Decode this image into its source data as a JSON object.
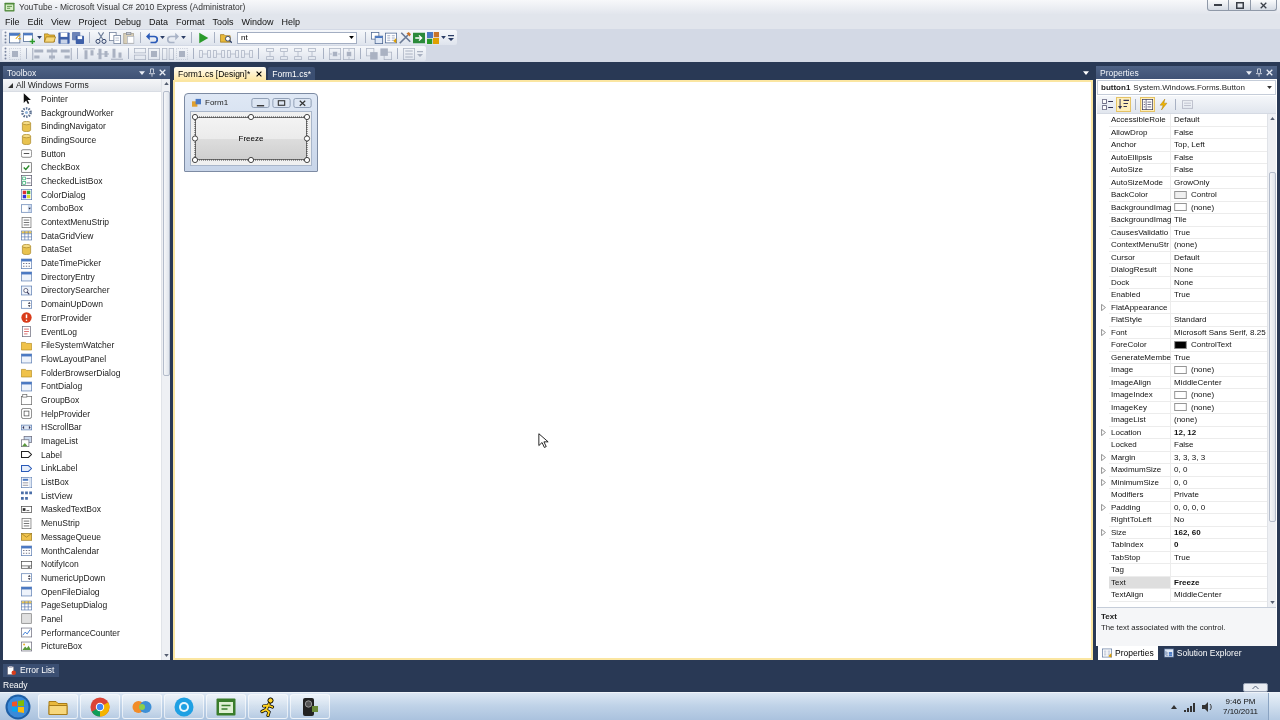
{
  "window": {
    "title": "YouTube - Microsoft Visual C# 2010 Express (Administrator)"
  },
  "menu": [
    "File",
    "Edit",
    "View",
    "Project",
    "Debug",
    "Data",
    "Format",
    "Tools",
    "Window",
    "Help"
  ],
  "standard_toolbar": {
    "find_value": "nt"
  },
  "layout_toolbar": {
    "disabled": true
  },
  "toolbox": {
    "title": "Toolbox",
    "group": {
      "label": "All Windows Forms",
      "expanded": true
    },
    "items": [
      "Pointer",
      "BackgroundWorker",
      "BindingNavigator",
      "BindingSource",
      "Button",
      "CheckBox",
      "CheckedListBox",
      "ColorDialog",
      "ComboBox",
      "ContextMenuStrip",
      "DataGridView",
      "DataSet",
      "DateTimePicker",
      "DirectoryEntry",
      "DirectorySearcher",
      "DomainUpDown",
      "ErrorProvider",
      "EventLog",
      "FileSystemWatcher",
      "FlowLayoutPanel",
      "FolderBrowserDialog",
      "FontDialog",
      "GroupBox",
      "HelpProvider",
      "HScrollBar",
      "ImageList",
      "Label",
      "LinkLabel",
      "ListBox",
      "ListView",
      "MaskedTextBox",
      "MenuStrip",
      "MessageQueue",
      "MonthCalendar",
      "NotifyIcon",
      "NumericUpDown",
      "OpenFileDialog",
      "PageSetupDialog",
      "Panel",
      "PerformanceCounter",
      "PictureBox"
    ]
  },
  "document_tabs": [
    {
      "label": "Form1.cs [Design]*",
      "selected": true
    },
    {
      "label": "Form1.cs*",
      "selected": false
    }
  ],
  "designer": {
    "form_title": "Form1",
    "button": {
      "text": "Freeze",
      "selected": true
    }
  },
  "properties": {
    "title": "Properties",
    "object_name": "button1",
    "object_type": "System.Windows.Forms.Button",
    "view_buttons": [
      {
        "selected": false,
        "disabled": false
      },
      {
        "selected": true,
        "disabled": false
      },
      {
        "selected": true,
        "disabled": false
      },
      {
        "selected": false,
        "disabled": false
      },
      {
        "selected": false,
        "disabled": true
      }
    ],
    "rows": [
      {
        "name": "AccessibleRole",
        "value": "Default",
        "kind": "plain",
        "expandable": false,
        "modified": false,
        "selected": false
      },
      {
        "name": "AllowDrop",
        "value": "False",
        "kind": "plain",
        "expandable": false,
        "modified": false,
        "selected": false
      },
      {
        "name": "Anchor",
        "value": "Top, Left",
        "kind": "plain",
        "expandable": false,
        "modified": false,
        "selected": false
      },
      {
        "name": "AutoEllipsis",
        "value": "False",
        "kind": "plain",
        "expandable": false,
        "modified": false,
        "selected": false
      },
      {
        "name": "AutoSize",
        "value": "False",
        "kind": "plain",
        "expandable": false,
        "modified": false,
        "selected": false
      },
      {
        "name": "AutoSizeMode",
        "value": "GrowOnly",
        "kind": "plain",
        "expandable": false,
        "modified": false,
        "selected": false
      },
      {
        "name": "BackColor",
        "value": "Control",
        "kind": "color",
        "color": "#f0f0f0",
        "expandable": false,
        "modified": false,
        "selected": false
      },
      {
        "name": "BackgroundImag",
        "value": "(none)",
        "kind": "image",
        "expandable": false,
        "modified": false,
        "selected": false
      },
      {
        "name": "BackgroundImag",
        "value": "Tile",
        "kind": "plain",
        "expandable": false,
        "modified": false,
        "selected": false
      },
      {
        "name": "CausesValidatio",
        "value": "True",
        "kind": "plain",
        "expandable": false,
        "modified": false,
        "selected": false
      },
      {
        "name": "ContextMenuStr",
        "value": "(none)",
        "kind": "plain",
        "expandable": false,
        "modified": false,
        "selected": false
      },
      {
        "name": "Cursor",
        "value": "Default",
        "kind": "plain",
        "expandable": false,
        "modified": false,
        "selected": false
      },
      {
        "name": "DialogResult",
        "value": "None",
        "kind": "plain",
        "expandable": false,
        "modified": false,
        "selected": false
      },
      {
        "name": "Dock",
        "value": "None",
        "kind": "plain",
        "expandable": false,
        "modified": false,
        "selected": false
      },
      {
        "name": "Enabled",
        "value": "True",
        "kind": "plain",
        "expandable": false,
        "modified": false,
        "selected": false
      },
      {
        "name": "FlatAppearance",
        "kind": "plain",
        "expandable": true,
        "selected": false
      },
      {
        "name": "FlatStyle",
        "value": "Standard",
        "kind": "plain",
        "expandable": false,
        "modified": false,
        "selected": false
      },
      {
        "name": "Font",
        "value": "Microsoft Sans Serif, 8.25",
        "kind": "plain",
        "expandable": true,
        "modified": false,
        "selected": false
      },
      {
        "name": "ForeColor",
        "value": "ControlText",
        "kind": "color",
        "color": "#000000",
        "expandable": false,
        "modified": false,
        "selected": false
      },
      {
        "name": "GenerateMembe",
        "value": "True",
        "kind": "plain",
        "expandable": false,
        "modified": false,
        "selected": false
      },
      {
        "name": "Image",
        "value": "(none)",
        "kind": "image",
        "expandable": false,
        "modified": false,
        "selected": false
      },
      {
        "name": "ImageAlign",
        "value": "MiddleCenter",
        "kind": "plain",
        "expandable": false,
        "modified": false,
        "selected": false
      },
      {
        "name": "ImageIndex",
        "value": "(none)",
        "kind": "image",
        "expandable": false,
        "modified": false,
        "selected": false
      },
      {
        "name": "ImageKey",
        "value": "(none)",
        "kind": "image",
        "expandable": false,
        "modified": false,
        "selected": false
      },
      {
        "name": "ImageList",
        "value": "(none)",
        "kind": "plain",
        "expandable": false,
        "modified": false,
        "selected": false
      },
      {
        "name": "Location",
        "value": "12, 12",
        "kind": "plain",
        "expandable": true,
        "modified": true,
        "selected": false
      },
      {
        "name": "Locked",
        "value": "False",
        "kind": "plain",
        "expandable": false,
        "modified": false,
        "selected": false
      },
      {
        "name": "Margin",
        "value": "3, 3, 3, 3",
        "kind": "plain",
        "expandable": true,
        "modified": false,
        "selected": false
      },
      {
        "name": "MaximumSize",
        "value": "0, 0",
        "kind": "plain",
        "expandable": true,
        "modified": false,
        "selected": false
      },
      {
        "name": "MinimumSize",
        "value": "0, 0",
        "kind": "plain",
        "expandable": true,
        "modified": false,
        "selected": false
      },
      {
        "name": "Modifiers",
        "value": "Private",
        "kind": "plain",
        "expandable": false,
        "modified": false,
        "selected": false
      },
      {
        "name": "Padding",
        "value": "0, 0, 0, 0",
        "kind": "plain",
        "expandable": true,
        "modified": false,
        "selected": false
      },
      {
        "name": "RightToLeft",
        "value": "No",
        "kind": "plain",
        "expandable": false,
        "modified": false,
        "selected": false
      },
      {
        "name": "Size",
        "value": "162, 60",
        "kind": "plain",
        "expandable": true,
        "modified": true,
        "selected": false
      },
      {
        "name": "TabIndex",
        "value": "0",
        "kind": "plain",
        "expandable": false,
        "modified": true,
        "selected": false
      },
      {
        "name": "TabStop",
        "value": "True",
        "kind": "plain",
        "expandable": false,
        "modified": false,
        "selected": false
      },
      {
        "name": "Tag",
        "kind": "plain",
        "expandable": false,
        "selected": false
      },
      {
        "name": "Text",
        "value": "Freeze",
        "kind": "plain",
        "expandable": false,
        "modified": true,
        "selected": true
      },
      {
        "name": "TextAlign",
        "value": "MiddleCenter",
        "kind": "plain",
        "expandable": false,
        "modified": false,
        "selected": false
      }
    ],
    "description": {
      "title": "Text",
      "text": "The text associated with the control."
    },
    "tabs": [
      {
        "label": "Properties",
        "selected": true
      },
      {
        "label": "Solution Explorer",
        "selected": false
      }
    ]
  },
  "error_list_tab": {
    "label": "Error List"
  },
  "status_bar": {
    "text": "Ready"
  },
  "taskbar": {
    "time": "9:46 PM",
    "date": "7/10/2011"
  }
}
